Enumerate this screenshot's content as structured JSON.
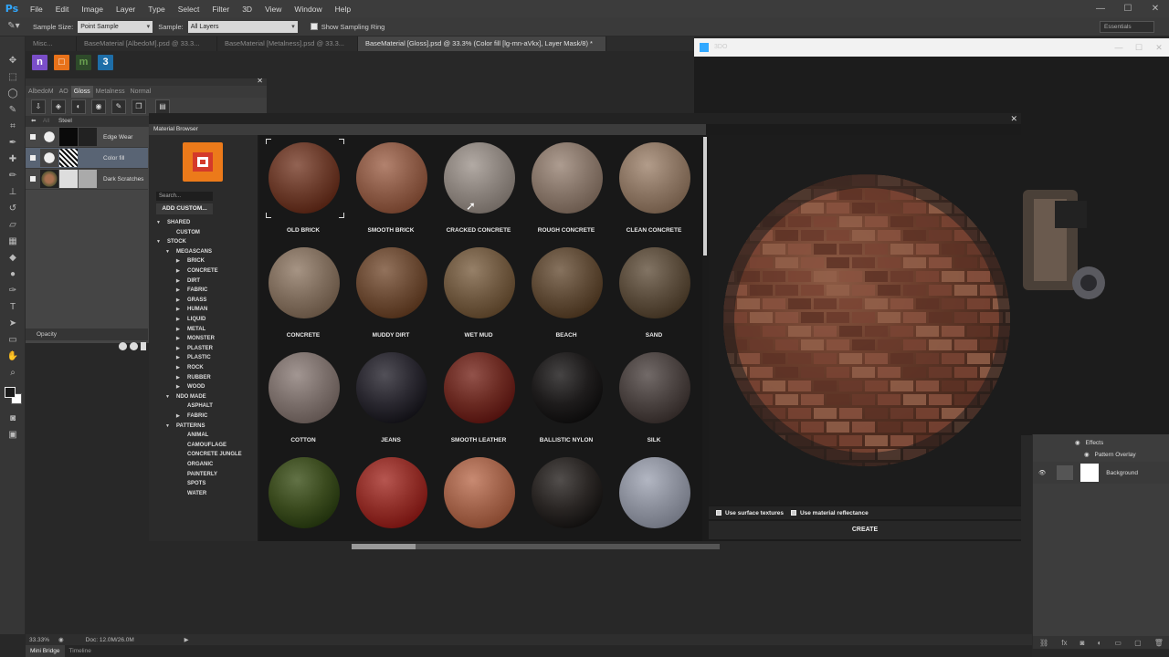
{
  "app": {
    "logo": "Ps"
  },
  "menu": [
    "File",
    "Edit",
    "Image",
    "Layer",
    "Type",
    "Select",
    "Filter",
    "3D",
    "View",
    "Window",
    "Help"
  ],
  "window_controls": [
    "—",
    "☐",
    "✕"
  ],
  "options_bar": {
    "sample_size_label": "Sample Size:",
    "sample_size_value": "Point Sample",
    "sample_label": "Sample:",
    "sample_value": "All Layers",
    "sampling_ring_label": "Show Sampling Ring",
    "workspace": "Essentials"
  },
  "doc_tabs": [
    {
      "label": "Misc...",
      "active": false
    },
    {
      "label": "BaseMaterial [AlbedoM].psd @ 33.3...",
      "active": false
    },
    {
      "label": "BaseMaterial [Metalness].psd @ 33.3...",
      "active": false
    },
    {
      "label": "BaseMaterial [Gloss].psd @ 33.3% (Color fill [lg-mn-aVkx], Layer Mask/8) *",
      "active": true
    }
  ],
  "layer_panel": {
    "tabs": [
      "AlbedoM",
      "AO",
      "Gloss",
      "Metalness",
      "Normal"
    ],
    "active_tab": "Gloss",
    "path": "Steel",
    "layers": [
      {
        "name": "Edge Wear",
        "selected": false
      },
      {
        "name": "Color fill",
        "selected": true
      },
      {
        "name": "Dark Scratches",
        "selected": false
      }
    ],
    "opacity_label": "Opacity"
  },
  "window_3do": {
    "title": "3DO"
  },
  "right_layers": {
    "effects": "Effects",
    "pattern_overlay": "Pattern Overlay",
    "background": "Background"
  },
  "status": {
    "zoom": "33.33%",
    "doc": "Doc: 12.0M/26.0M"
  },
  "bottom_tabs": [
    "Mini Bridge",
    "Timeline"
  ],
  "material_browser": {
    "title": "Material Browser",
    "search_placeholder": "Search...",
    "add_custom": "ADD CUSTOM...",
    "tree": [
      {
        "label": "SHARED",
        "level": 0,
        "arrow": "down"
      },
      {
        "label": "CUSTOM",
        "level": 1,
        "arrow": ""
      },
      {
        "label": "STOCK",
        "level": 0,
        "arrow": "down"
      },
      {
        "label": "MEGASCANS",
        "level": 1,
        "arrow": "down"
      },
      {
        "label": "BRICK",
        "level": 2,
        "arrow": "right"
      },
      {
        "label": "CONCRETE",
        "level": 2,
        "arrow": "right"
      },
      {
        "label": "DIRT",
        "level": 2,
        "arrow": "right"
      },
      {
        "label": "FABRIC",
        "level": 2,
        "arrow": "right"
      },
      {
        "label": "GRASS",
        "level": 2,
        "arrow": "right"
      },
      {
        "label": "HUMAN",
        "level": 2,
        "arrow": "right"
      },
      {
        "label": "LIQUID",
        "level": 2,
        "arrow": "right"
      },
      {
        "label": "METAL",
        "level": 2,
        "arrow": "right"
      },
      {
        "label": "MONSTER",
        "level": 2,
        "arrow": "right"
      },
      {
        "label": "PLASTER",
        "level": 2,
        "arrow": "right"
      },
      {
        "label": "PLASTIC",
        "level": 2,
        "arrow": "right"
      },
      {
        "label": "ROCK",
        "level": 2,
        "arrow": "right"
      },
      {
        "label": "RUBBER",
        "level": 2,
        "arrow": "right"
      },
      {
        "label": "WOOD",
        "level": 2,
        "arrow": "right"
      },
      {
        "label": "NDO MADE",
        "level": 1,
        "arrow": "down"
      },
      {
        "label": "ASPHALT",
        "level": 2,
        "arrow": ""
      },
      {
        "label": "FABRIC",
        "level": 2,
        "arrow": "right"
      },
      {
        "label": "PATTERNS",
        "level": 1,
        "arrow": "down"
      },
      {
        "label": "ANIMAL",
        "level": 2,
        "arrow": ""
      },
      {
        "label": "CAMOUFLAGE",
        "level": 2,
        "arrow": ""
      },
      {
        "label": "CONCRETE JUNGLE",
        "level": 2,
        "arrow": ""
      },
      {
        "label": "ORGANIC",
        "level": 2,
        "arrow": ""
      },
      {
        "label": "PAINTERLY",
        "level": 2,
        "arrow": ""
      },
      {
        "label": "SPOTS",
        "level": 2,
        "arrow": ""
      },
      {
        "label": "WATER",
        "level": 2,
        "arrow": ""
      }
    ],
    "materials": [
      {
        "label": "OLD BRICK",
        "color": "#6a3b2b",
        "selected": true
      },
      {
        "label": "SMOOTH BRICK",
        "color": "#8a5a46"
      },
      {
        "label": "CRACKED CONCRETE",
        "color": "#8a827c"
      },
      {
        "label": "ROUGH CONCRETE",
        "color": "#857468"
      },
      {
        "label": "CLEAN CONCRETE",
        "color": "#8a7462"
      },
      {
        "label": "CONCRETE",
        "color": "#7e6c5c"
      },
      {
        "label": "MUDDY DIRT",
        "color": "#6a4a34"
      },
      {
        "label": "WET MUD",
        "color": "#6e5840"
      },
      {
        "label": "BEACH",
        "color": "#5e4a36"
      },
      {
        "label": "SAND",
        "color": "#5a4c3c"
      },
      {
        "label": "COTTON",
        "color": "#7a6e6a"
      },
      {
        "label": "JEANS",
        "color": "#2a2830"
      },
      {
        "label": "SMOOTH LEATHER",
        "color": "#6a2a22"
      },
      {
        "label": "BALLISTIC NYLON",
        "color": "#1e1c1c"
      },
      {
        "label": "SILK",
        "color": "#4a4240"
      },
      {
        "label": "",
        "color": "#3a4a1e"
      },
      {
        "label": "",
        "color": "#8e2e28"
      },
      {
        "label": "",
        "color": "#a0624a"
      },
      {
        "label": "",
        "color": "#2a2624"
      },
      {
        "label": "",
        "color": "#8a8e9a"
      }
    ],
    "use_surface_textures": "Use surface textures",
    "use_material_reflectance": "Use material reflectance",
    "create": "CREATE"
  }
}
